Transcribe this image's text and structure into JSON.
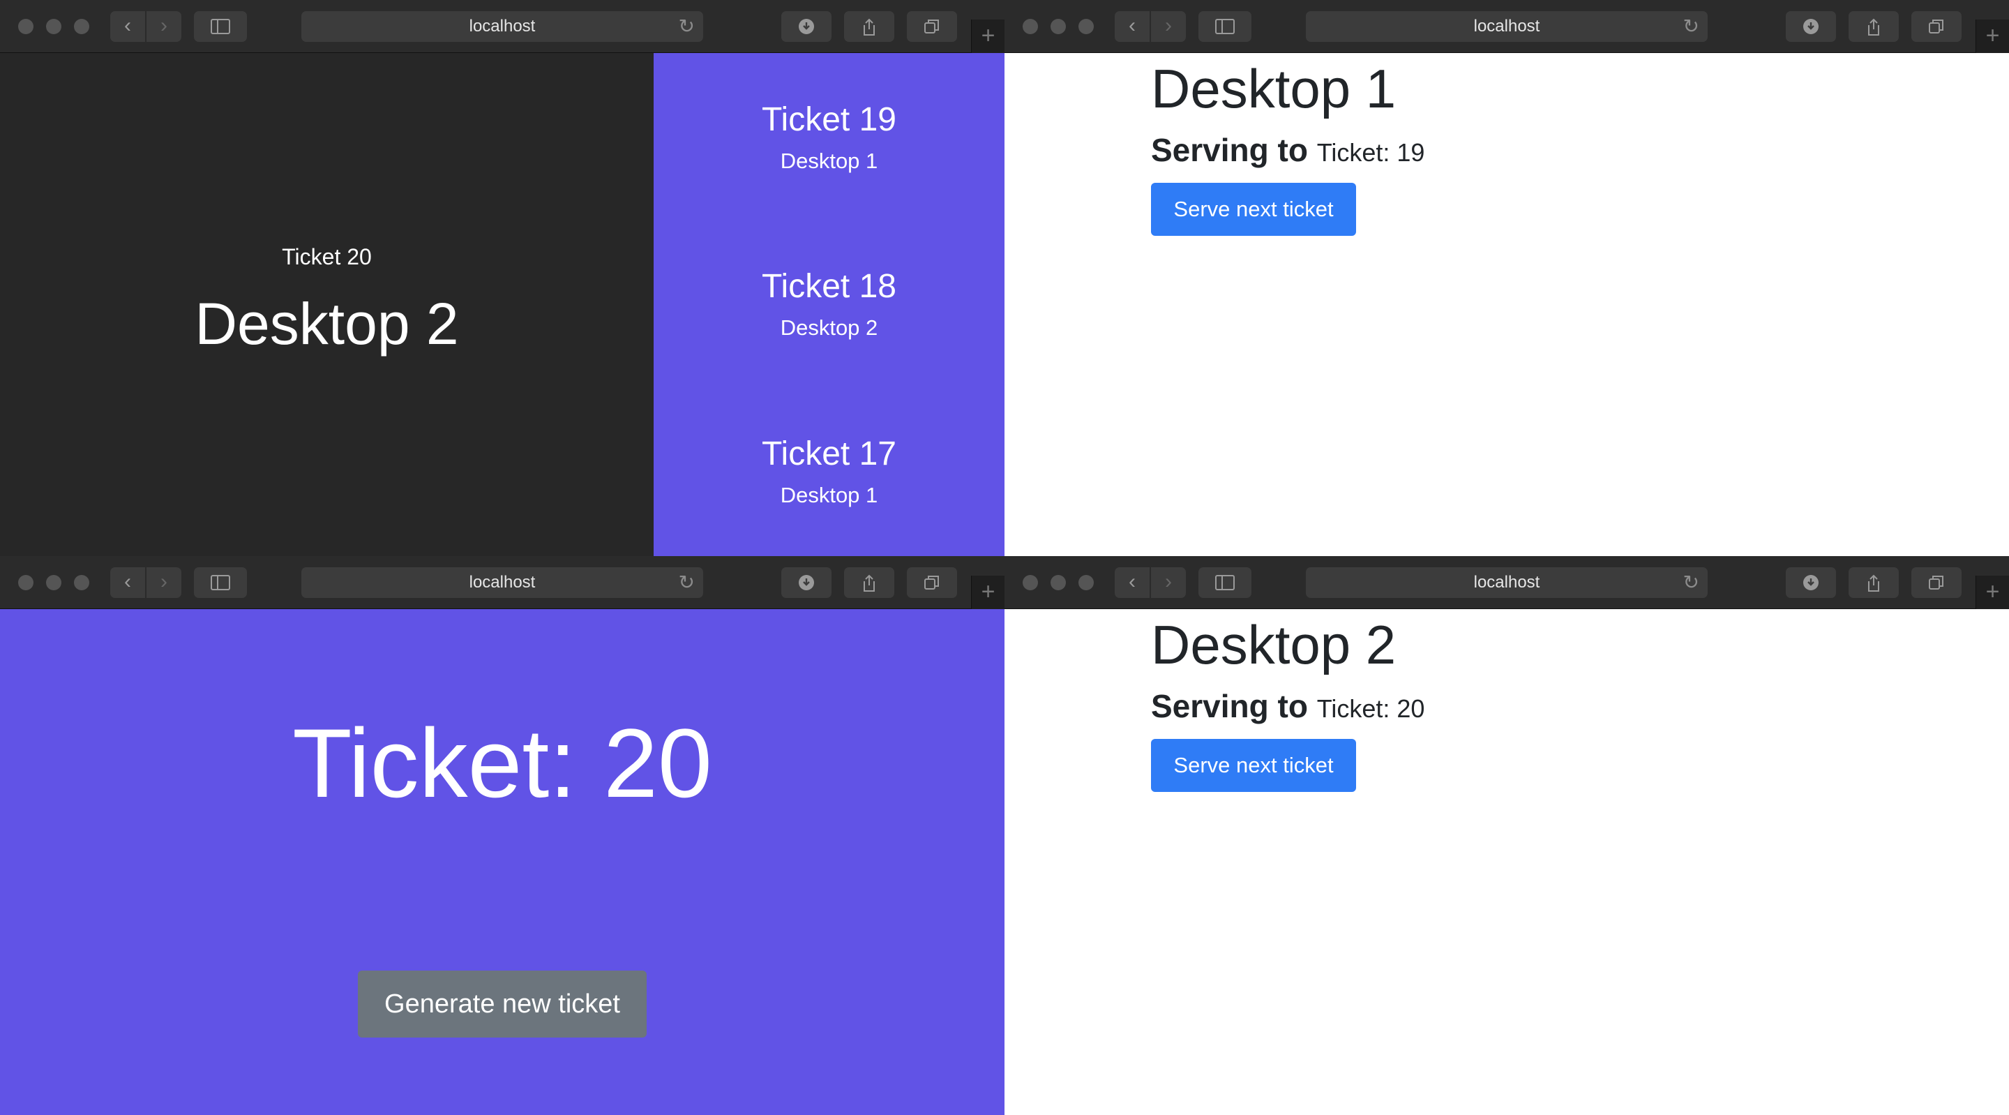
{
  "browser": {
    "address": "localhost"
  },
  "public_screen": {
    "current_ticket": "Ticket 20",
    "current_desktop": "Desktop 2",
    "history": [
      {
        "ticket": "Ticket 19",
        "desktop": "Desktop 1"
      },
      {
        "ticket": "Ticket 18",
        "desktop": "Desktop 2"
      },
      {
        "ticket": "Ticket 17",
        "desktop": "Desktop 1"
      }
    ]
  },
  "desktop1": {
    "title": "Desktop 1",
    "serving_label": "Serving to",
    "serving_ticket": "Ticket: 19",
    "button": "Serve next ticket"
  },
  "desktop2": {
    "title": "Desktop 2",
    "serving_label": "Serving to",
    "serving_ticket": "Ticket: 20",
    "button": "Serve next ticket"
  },
  "generator": {
    "ticket": "Ticket: 20",
    "button": "Generate new ticket"
  },
  "colors": {
    "purple": "#6153e6",
    "dark": "#272727",
    "primary_button": "#2f7cf6",
    "secondary_button": "#6c757d"
  }
}
